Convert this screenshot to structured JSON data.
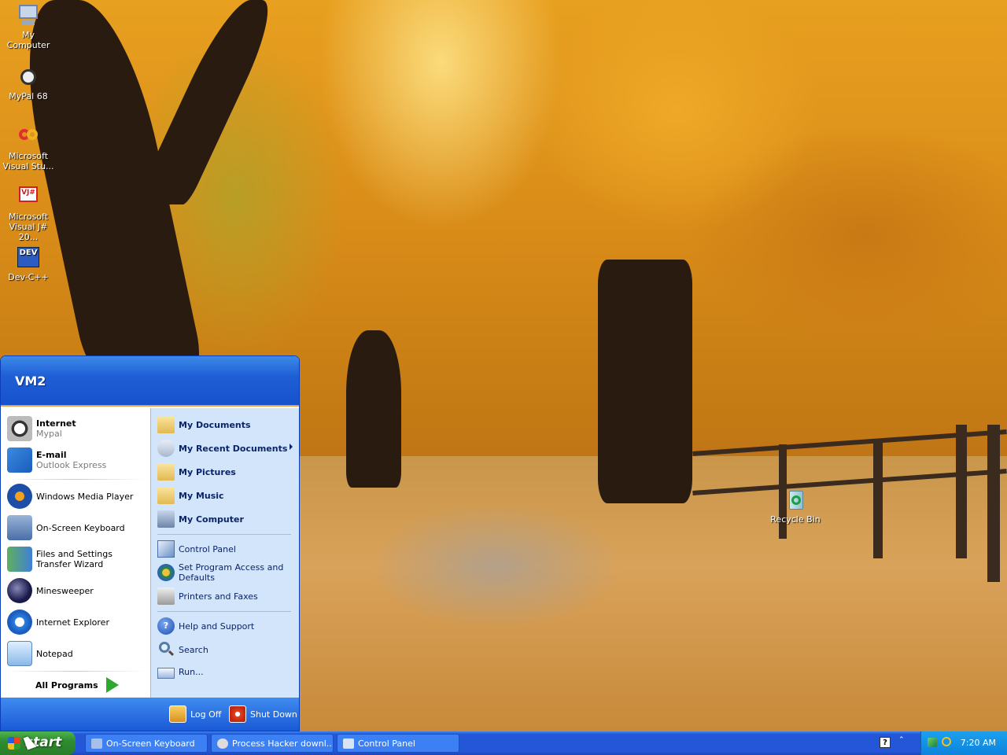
{
  "desktop": {
    "icons": [
      {
        "label": "My Computer",
        "icon": "computer-icon"
      },
      {
        "label": "MyPal 68",
        "icon": "mypal-icon"
      },
      {
        "label": "Microsoft Visual Stu...",
        "icon": "visual-studio-icon"
      },
      {
        "label": "Microsoft Visual J# 20...",
        "icon": "visual-jsharp-icon"
      },
      {
        "label": "Dev-C++",
        "icon": "devcpp-icon"
      },
      {
        "label": "Recycle Bin",
        "icon": "recycle-bin-icon"
      }
    ]
  },
  "start_menu": {
    "user": "VM2",
    "pinned": [
      {
        "title": "Internet",
        "subtitle": "Mypal"
      },
      {
        "title": "E-mail",
        "subtitle": "Outlook Express"
      }
    ],
    "recent": [
      {
        "title": "Windows Media Player"
      },
      {
        "title": "On-Screen Keyboard"
      },
      {
        "title": "Files and Settings Transfer Wizard"
      },
      {
        "title": "Minesweeper"
      },
      {
        "title": "Internet Explorer"
      },
      {
        "title": "Notepad"
      }
    ],
    "all_programs": "All Programs",
    "places": [
      {
        "label": "My Documents"
      },
      {
        "label": "My Recent Documents"
      },
      {
        "label": "My Pictures"
      },
      {
        "label": "My Music"
      },
      {
        "label": "My Computer"
      }
    ],
    "settings": [
      {
        "label": "Control Panel"
      },
      {
        "label": "Set Program Access and Defaults"
      },
      {
        "label": "Printers and Faxes"
      }
    ],
    "tools": [
      {
        "label": "Help and Support"
      },
      {
        "label": "Search"
      },
      {
        "label": "Run..."
      }
    ],
    "log_off": "Log Off",
    "shut_down": "Shut Down"
  },
  "taskbar": {
    "start_label": "start",
    "tasks": [
      {
        "label": "On-Screen Keyboard"
      },
      {
        "label": "Process Hacker downl..."
      },
      {
        "label": "Control Panel"
      }
    ],
    "clock": "7:20 AM"
  },
  "colors": {
    "xp_blue": "#2456d8",
    "start_green": "#2f8d2f",
    "menu_right_bg": "#d3e5fa"
  }
}
